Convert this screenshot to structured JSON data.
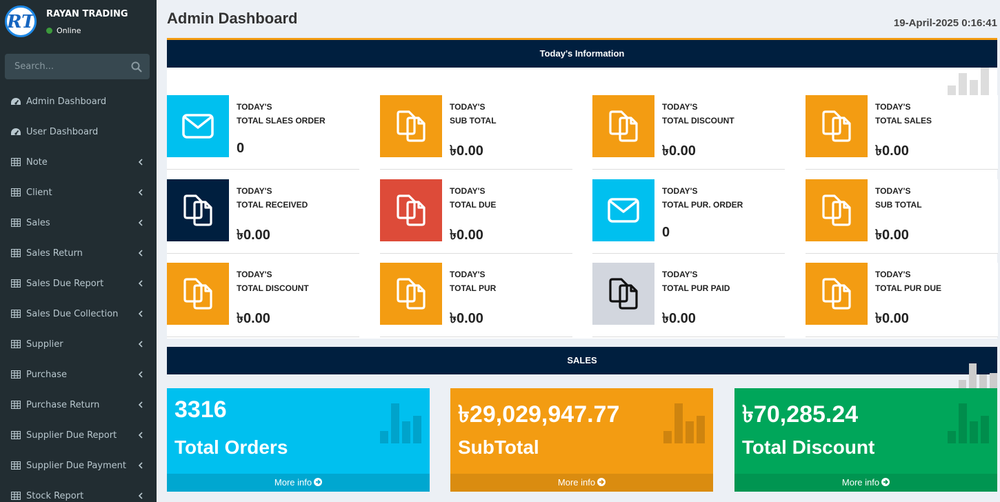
{
  "brand": {
    "name": "RAYAN TRADING",
    "status": "Online",
    "logo_text": "RT"
  },
  "search": {
    "placeholder": "Search..."
  },
  "menu": [
    {
      "label": "Admin Dashboard",
      "icon": "dashboard-icon",
      "has_children": false
    },
    {
      "label": "User Dashboard",
      "icon": "dashboard-icon",
      "has_children": false
    },
    {
      "label": "Note",
      "icon": "table-icon",
      "has_children": true
    },
    {
      "label": "Client",
      "icon": "table-icon",
      "has_children": true
    },
    {
      "label": "Sales",
      "icon": "table-icon",
      "has_children": true
    },
    {
      "label": "Sales Return",
      "icon": "table-icon",
      "has_children": true
    },
    {
      "label": "Sales Due Report",
      "icon": "table-icon",
      "has_children": true
    },
    {
      "label": "Sales Due Collection",
      "icon": "table-icon",
      "has_children": true
    },
    {
      "label": "Supplier",
      "icon": "table-icon",
      "has_children": true
    },
    {
      "label": "Purchase",
      "icon": "table-icon",
      "has_children": true
    },
    {
      "label": "Purchase Return",
      "icon": "table-icon",
      "has_children": true
    },
    {
      "label": "Supplier Due Report",
      "icon": "table-icon",
      "has_children": true
    },
    {
      "label": "Supplier Due Payment",
      "icon": "table-icon",
      "has_children": true
    },
    {
      "label": "Stock Report",
      "icon": "table-icon",
      "has_children": true
    }
  ],
  "header": {
    "title": "Admin Dashboard",
    "datetime": "19-April-2025 0:16:41"
  },
  "info": {
    "title": "Today's Information",
    "boxes": [
      {
        "line1": "TODAY'S",
        "line2": "TOTAL SLAES ORDER",
        "value": "0",
        "icon": "envelope-icon",
        "color": "#00c0ef"
      },
      {
        "line1": "TODAY'S",
        "line2": "SUB TOTAL",
        "value": "৳0.00",
        "icon": "copy-icon",
        "color": "#f39c12"
      },
      {
        "line1": "TODAY'S",
        "line2": "TOTAL DISCOUNT",
        "value": "৳0.00",
        "icon": "copy-icon",
        "color": "#f39c12"
      },
      {
        "line1": "TODAY'S",
        "line2": "TOTAL SALES",
        "value": "৳0.00",
        "icon": "copy-icon",
        "color": "#f39c12"
      },
      {
        "line1": "TODAY'S",
        "line2": "TOTAL RECEIVED",
        "value": "৳0.00",
        "icon": "copy-icon",
        "color": "#001f3f"
      },
      {
        "line1": "TODAY'S",
        "line2": "TOTAL DUE",
        "value": "৳0.00",
        "icon": "copy-icon",
        "color": "#dd4b39"
      },
      {
        "line1": "TODAY'S",
        "line2": "TOTAL PUR. ORDER",
        "value": "0",
        "icon": "envelope-icon",
        "color": "#00c0ef"
      },
      {
        "line1": "TODAY'S",
        "line2": "SUB TOTAL",
        "value": "৳0.00",
        "icon": "copy-icon",
        "color": "#f39c12"
      },
      {
        "line1": "TODAY'S",
        "line2": "TOTAL DISCOUNT",
        "value": "৳0.00",
        "icon": "copy-icon",
        "color": "#f39c12"
      },
      {
        "line1": "TODAY'S",
        "line2": "TOTAL PUR",
        "value": "৳0.00",
        "icon": "copy-icon",
        "color": "#f39c12"
      },
      {
        "line1": "TODAY'S",
        "line2": "TOTAL PUR PAID",
        "value": "৳0.00",
        "icon": "copy-icon",
        "color": "#d2d6de"
      },
      {
        "line1": "TODAY'S",
        "line2": "TOTAL PUR DUE",
        "value": "৳0.00",
        "icon": "copy-icon",
        "color": "#f39c12"
      }
    ]
  },
  "sales": {
    "title": "SALES",
    "boxes": [
      {
        "value": "3316",
        "label": "Total Orders",
        "footer": "More info",
        "color": "#00c0ef",
        "footer_color": "#00a7d0"
      },
      {
        "value": "৳29,029,947.77",
        "label": "SubTotal",
        "footer": "More info",
        "color": "#f39c12",
        "footer_color": "#da8c10"
      },
      {
        "value": "৳70,285.24",
        "label": "Total Discount",
        "footer": "More info",
        "color": "#00a65a",
        "footer_color": "#009551"
      }
    ]
  }
}
